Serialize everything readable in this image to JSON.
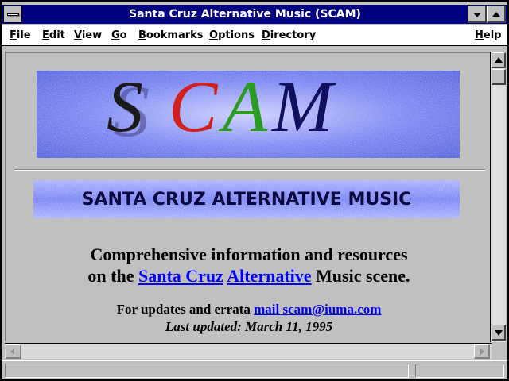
{
  "window": {
    "title": "Santa Cruz Alternative Music (SCAM)"
  },
  "menu": {
    "file": "File",
    "edit": "Edit",
    "view": "View",
    "go": "Go",
    "bookmarks": "Bookmarks",
    "options": "Options",
    "directory": "Directory",
    "help": "Help"
  },
  "page": {
    "logo_text": "SCAM",
    "logo_letter_colors": [
      "#1a1a1a",
      "#d02020",
      "#2a9a20",
      "#c8b020",
      "#101060"
    ],
    "subtitle_banner": "SANTA CRUZ ALTERNATIVE MUSIC",
    "headline_line1": "Comprehensive information and resources",
    "headline_line2_prefix": "on the",
    "link_santa_cruz": "Santa Cruz",
    "link_alternative": "Alternative",
    "headline_line2_suffix": "Music scene.",
    "updates_prefix": "For updates and errata",
    "mail_link": "mail scam@iuma.com",
    "last_updated": "Last updated: March 11, 1995"
  },
  "colors": {
    "titlebar": "#000080",
    "link": "#0000ff",
    "banner_blue": "#4a55e8",
    "page_background": "#c0c0c0"
  }
}
